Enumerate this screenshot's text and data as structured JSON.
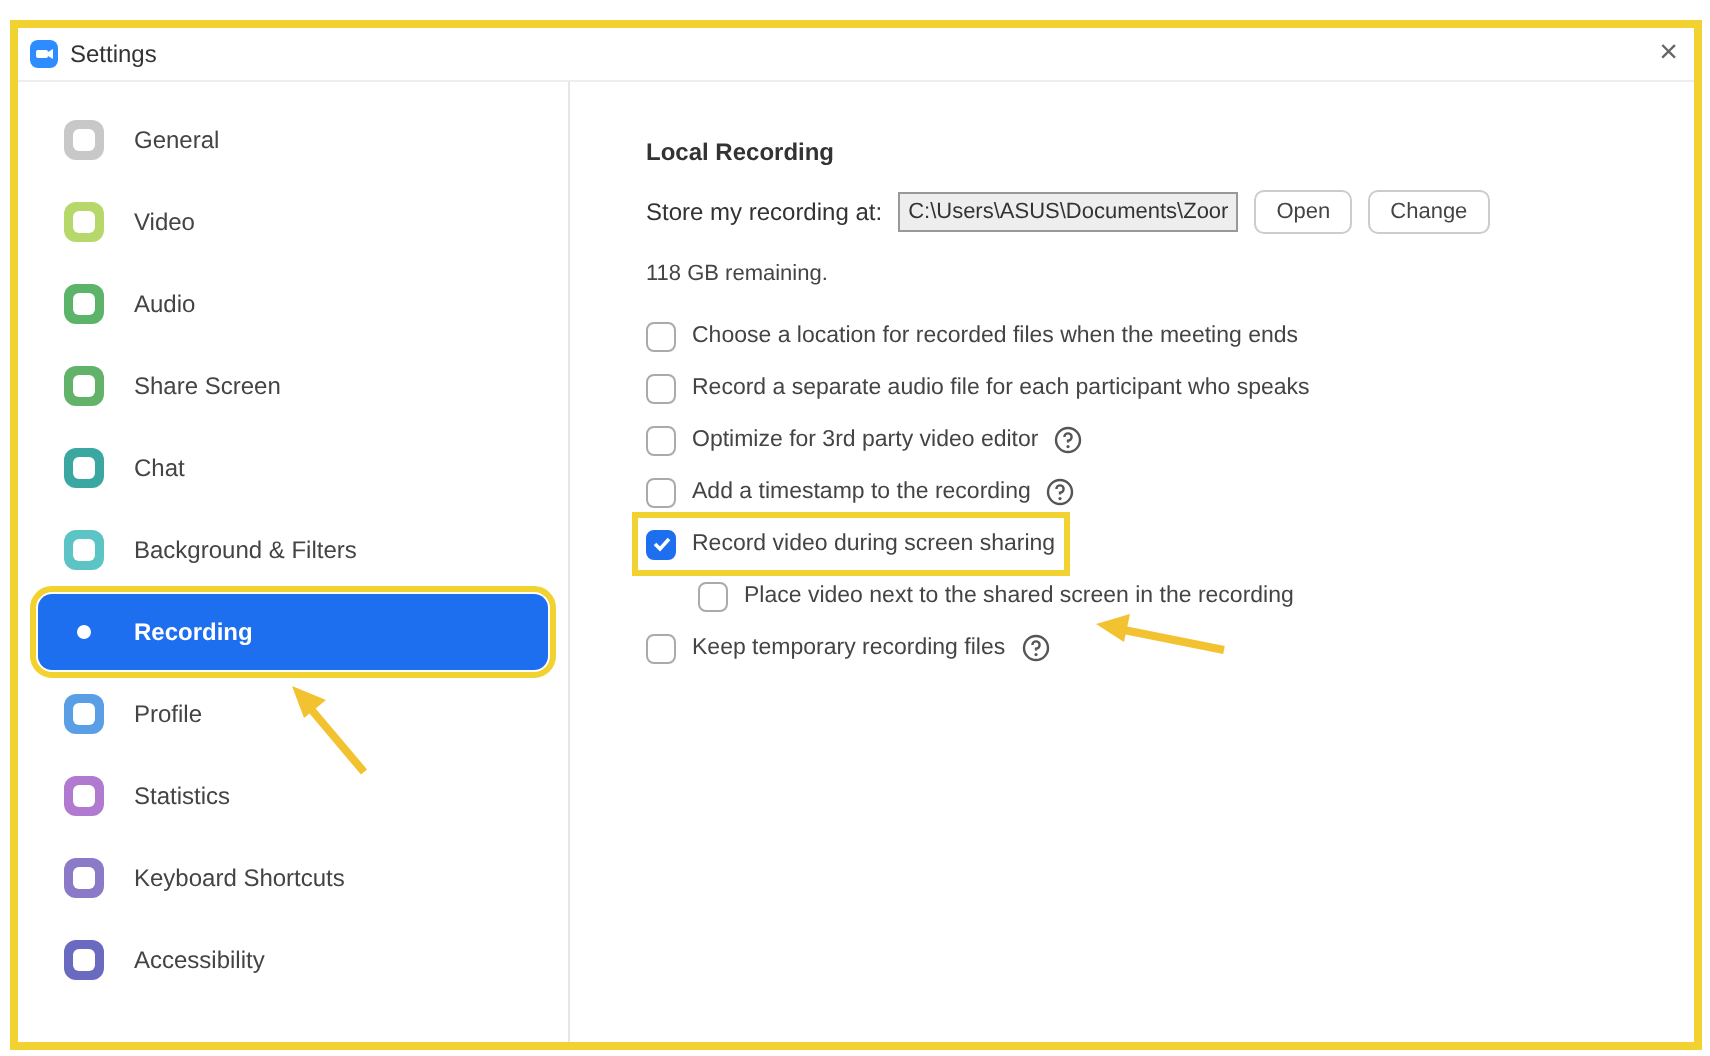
{
  "window": {
    "title": "Settings",
    "close": "×"
  },
  "sidebar": {
    "items": [
      {
        "label": "General",
        "selected": false,
        "highlighted": false,
        "color": "#c8c8c8"
      },
      {
        "label": "Video",
        "selected": false,
        "highlighted": false,
        "color": "#b6d86a"
      },
      {
        "label": "Audio",
        "selected": false,
        "highlighted": false,
        "color": "#5cb46a"
      },
      {
        "label": "Share Screen",
        "selected": false,
        "highlighted": false,
        "color": "#62b26a"
      },
      {
        "label": "Chat",
        "selected": false,
        "highlighted": false,
        "color": "#3aa8a0"
      },
      {
        "label": "Background & Filters",
        "selected": false,
        "highlighted": false,
        "color": "#5cc4c4"
      },
      {
        "label": "Recording",
        "selected": true,
        "highlighted": true,
        "color": "#1e6ef0"
      },
      {
        "label": "Profile",
        "selected": false,
        "highlighted": false,
        "color": "#5a9ee6"
      },
      {
        "label": "Statistics",
        "selected": false,
        "highlighted": false,
        "color": "#b07ad0"
      },
      {
        "label": "Keyboard Shortcuts",
        "selected": false,
        "highlighted": false,
        "color": "#8a7ac8"
      },
      {
        "label": "Accessibility",
        "selected": false,
        "highlighted": false,
        "color": "#6a6ac0"
      }
    ]
  },
  "content": {
    "heading": "Local Recording",
    "store_label": "Store my recording at:",
    "path": "C:\\Users\\ASUS\\Documents\\Zoor",
    "buttons": [
      "Open",
      "Change"
    ],
    "remaining": "118 GB remaining.",
    "options": [
      {
        "label": "Choose a location for recorded files when the meeting ends",
        "checked": false,
        "help": false,
        "highlighted": false
      },
      {
        "label": "Record a separate audio file for each participant who speaks",
        "checked": false,
        "help": false,
        "highlighted": false
      },
      {
        "label": "Optimize for 3rd party video editor",
        "checked": false,
        "help": true,
        "highlighted": false
      },
      {
        "label": "Add a timestamp to the recording",
        "checked": false,
        "help": true,
        "highlighted": false
      },
      {
        "label": "Record video during screen sharing",
        "checked": true,
        "help": false,
        "highlighted": true,
        "children": [
          {
            "label": "Place video next to the shared screen in the recording",
            "checked": false,
            "help": false,
            "highlighted": false
          }
        ]
      },
      {
        "label": "Keep temporary recording files",
        "checked": false,
        "help": true,
        "highlighted": false
      }
    ]
  }
}
